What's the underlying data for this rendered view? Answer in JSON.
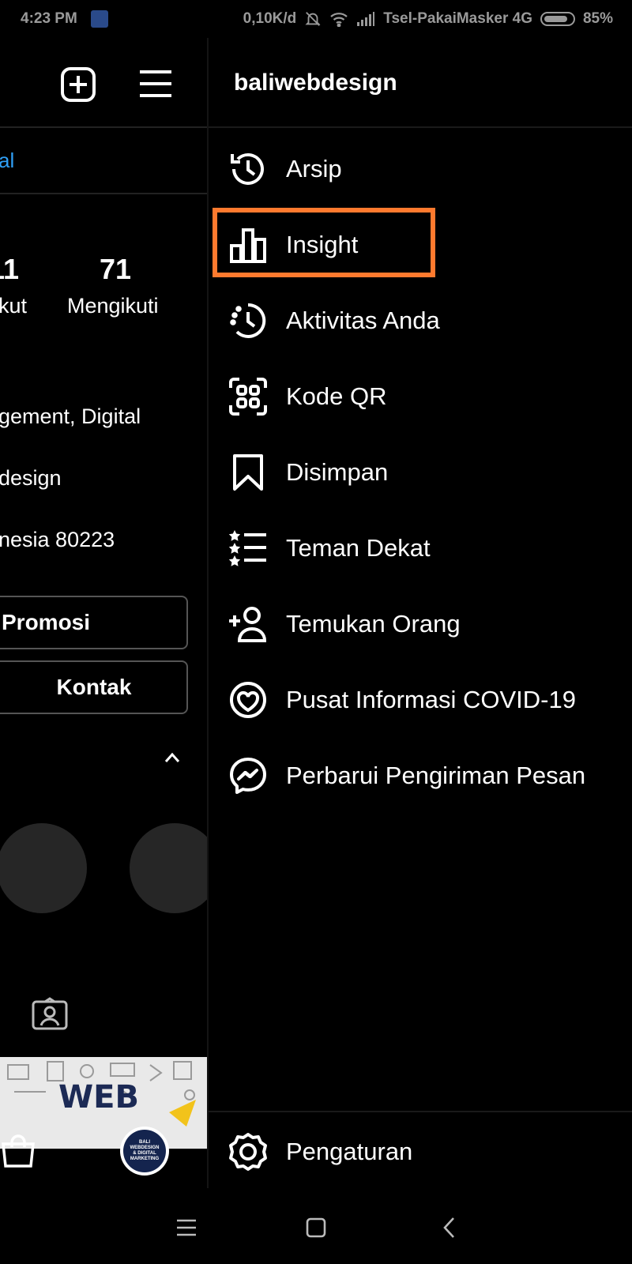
{
  "status_bar": {
    "time": "4:23 PM",
    "speed": "0,10K/d",
    "carrier": "Tsel-PakaiMasker 4G",
    "battery": "85%",
    "battery_level": 0.85
  },
  "profile": {
    "tab_partial": "al",
    "stat_left_number": "11",
    "stat_left_label": "kut",
    "following_count": "71",
    "following_label": "Mengikuti",
    "bio_line1": "gement, Digital",
    "bio_line2": "design",
    "bio_line3": "nesia 80223",
    "promo_button": "Promosi",
    "contact_button": "Kontak",
    "banner_text": "WEB",
    "avatar_text": "BALI WEBDESIGN & DIGITAL MARKETING"
  },
  "drawer": {
    "username": "baliwebdesign",
    "items": [
      {
        "label": "Arsip",
        "icon": "archive-icon"
      },
      {
        "label": "Insight",
        "icon": "insights-icon"
      },
      {
        "label": "Aktivitas Anda",
        "icon": "activity-icon"
      },
      {
        "label": "Kode QR",
        "icon": "qr-code-icon"
      },
      {
        "label": "Disimpan",
        "icon": "bookmark-icon"
      },
      {
        "label": "Teman Dekat",
        "icon": "close-friends-icon"
      },
      {
        "label": "Temukan Orang",
        "icon": "add-person-icon"
      },
      {
        "label": "Pusat Informasi COVID-19",
        "icon": "covid-info-icon"
      },
      {
        "label": "Perbarui Pengiriman Pesan",
        "icon": "messenger-icon"
      }
    ],
    "settings_label": "Pengaturan",
    "highlight_color": "#ff7a2e"
  }
}
